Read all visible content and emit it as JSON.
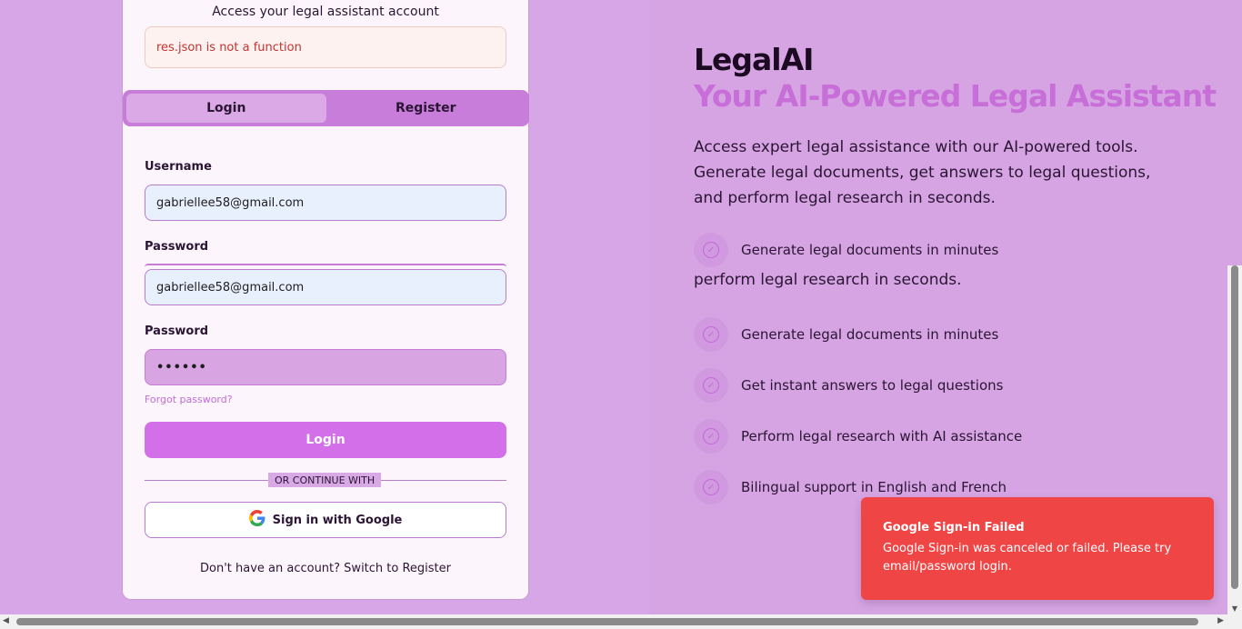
{
  "login_card": {
    "subtitle": "Access your legal assistant account",
    "error_message": "res.json is not a function",
    "tabs": [
      {
        "label": "Login",
        "active": true
      },
      {
        "label": "Register",
        "active": false
      }
    ],
    "username_label": "Username",
    "username_value": "gabriellee58@gmail.com",
    "password_label": "Password",
    "email_value": "gabriellee58@gmail.com",
    "password2_label": "Password",
    "password_value": "••••••",
    "forgot_password": "Forgot password?",
    "login_button": "Login",
    "divider_text": "OR CONTINUE WITH",
    "google_button": "Sign in with Google",
    "switch_text": "Don't have an account? Switch to Register"
  },
  "hero": {
    "brand": "LegalAI",
    "tagline": "Your AI-Powered Legal Assistant",
    "description": "Access expert legal assistance with our AI-powered tools. Generate legal documents, get answers to legal questions, and perform legal research in seconds.",
    "description_repeat": "perform legal research in seconds.",
    "features": [
      "Generate legal documents in minutes",
      "Generate legal documents in minutes",
      "Get instant answers to legal questions",
      "Perform legal research with AI assistance",
      "Bilingual support in English and French"
    ]
  },
  "toast": {
    "title": "Google Sign-in Failed",
    "description": "Google Sign-in was canceled or failed. Please try email/password login."
  },
  "colors": {
    "background": "#d7a6e6",
    "accent": "#d36fe8",
    "error": "#ef4545",
    "tagline": "#c86ed8"
  }
}
